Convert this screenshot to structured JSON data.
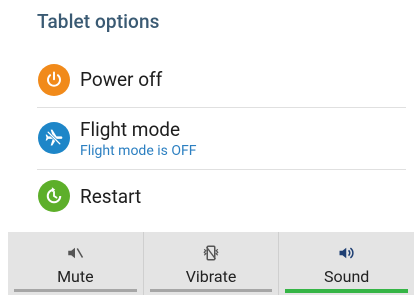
{
  "dialog": {
    "title": "Tablet options"
  },
  "options": {
    "power": {
      "label": "Power off",
      "icon": "power-icon",
      "color": "#f18a1a"
    },
    "flight": {
      "label": "Flight mode",
      "status": "Flight mode is OFF",
      "icon": "airplane-icon",
      "color": "#1e86c8"
    },
    "restart": {
      "label": "Restart",
      "icon": "restart-icon",
      "color": "#5daf2a"
    }
  },
  "sound_modes": {
    "mute": {
      "label": "Mute",
      "icon": "mute-icon"
    },
    "vibrate": {
      "label": "Vibrate",
      "icon": "vibrate-icon"
    },
    "sound": {
      "label": "Sound",
      "icon": "sound-icon",
      "active": true
    },
    "active_color": "#35b546"
  }
}
